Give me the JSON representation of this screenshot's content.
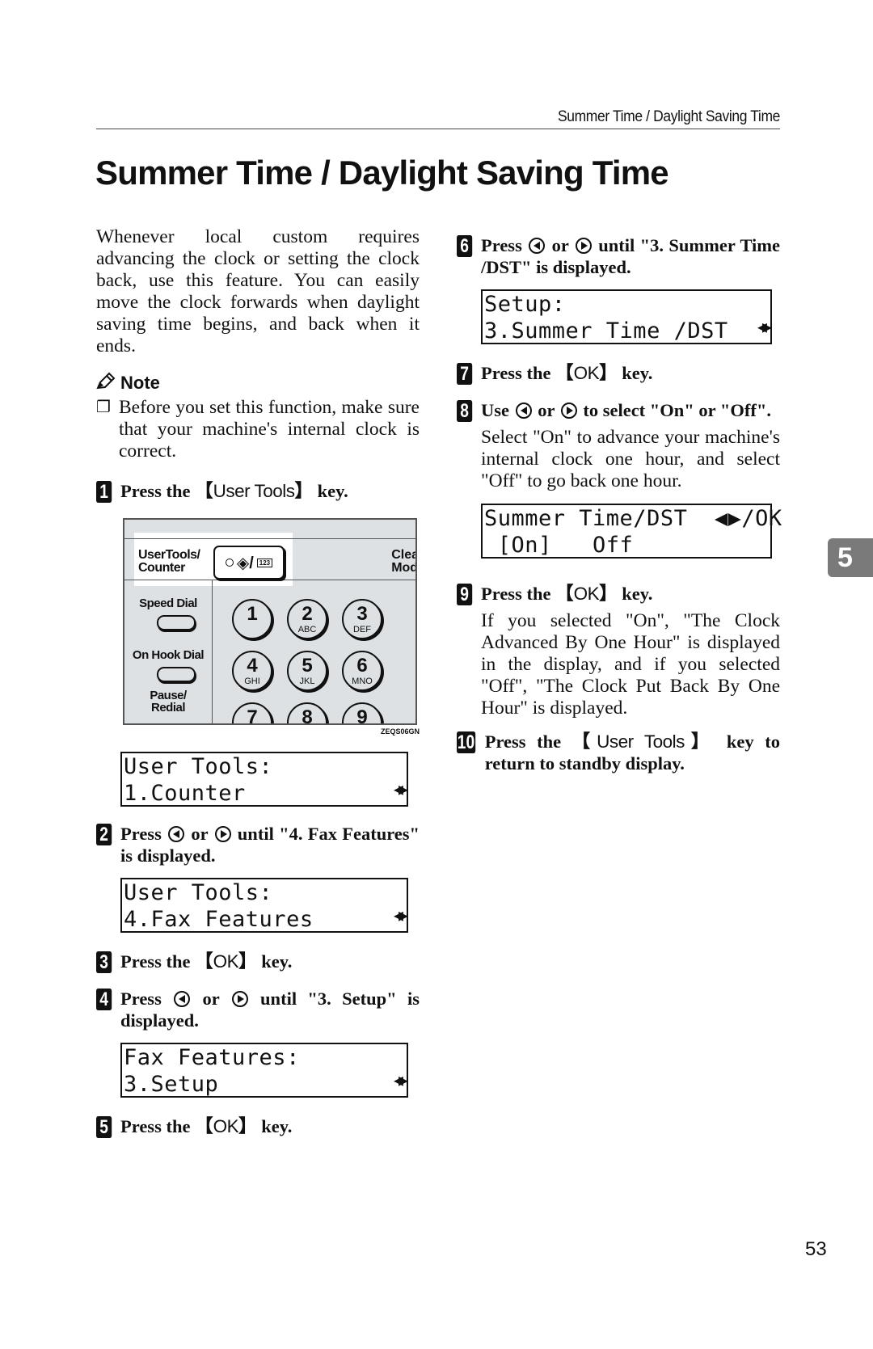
{
  "running_header": "Summer Time / Daylight Saving Time",
  "page_title": "Summer Time / Daylight Saving Time",
  "intro": "Whenever local custom requires advancing the clock or setting the clock back, use this feature. You can easily move the clock forwards when daylight saving time begins, and back when it ends.",
  "note": {
    "label": "Note",
    "items": [
      "Before you set this function, make sure that your machine's internal clock is correct."
    ]
  },
  "steps": [
    {
      "num": "1",
      "pre": "Press the ",
      "key": "User Tools",
      "post": " key."
    },
    {
      "num": "2",
      "pre": "Press",
      "mid": "or",
      "post": "until \"4. Fax Features\" is displayed."
    },
    {
      "num": "3",
      "pre": "Press the ",
      "key": "OK",
      "post": " key."
    },
    {
      "num": "4",
      "pre": "Press",
      "mid": "or",
      "post": "until \"3. Setup\" is displayed."
    },
    {
      "num": "5",
      "pre": "Press the ",
      "key": "OK",
      "post": " key."
    },
    {
      "num": "6",
      "pre": "Press",
      "mid": "or",
      "post": "until \"3. Summer Time /DST\" is displayed."
    },
    {
      "num": "7",
      "pre": "Press the ",
      "key": "OK",
      "post": " key."
    },
    {
      "num": "8",
      "pre": "Use",
      "mid": "or",
      "post": "to select \"On\" or \"Off\".",
      "desc": "Select \"On\" to advance your machine's internal clock one hour, and select \"Off\" to go back one hour."
    },
    {
      "num": "9",
      "pre": "Press the ",
      "key": "OK",
      "post": " key.",
      "desc": "If you selected \"On\", \"The Clock Advanced By One Hour\" is displayed in the display, and if you selected \"Off\", \"The Clock Put Back By One Hour\" is displayed."
    },
    {
      "num": "10",
      "pre": "Press the ",
      "key": "User Tools",
      "post": " key to return to standby display."
    }
  ],
  "lcd_screens": [
    {
      "line1": "User Tools:",
      "line2": "1.Counter",
      "nav": "◀▶"
    },
    {
      "line1": "User Tools:",
      "line2": "4.Fax Features",
      "nav": "◀▶"
    },
    {
      "line1": "Fax Features:",
      "line2": "3.Setup",
      "nav": "◀▶"
    },
    {
      "line1": "Setup:",
      "line2": "3.Summer Time /DST",
      "nav": "◀▶"
    },
    {
      "line1": "Summer Time/DST  ◀▶/OK",
      "line2": " [On]   Off",
      "nav": ""
    }
  ],
  "control_panel": {
    "user_tools_label_1": "UserTools/",
    "user_tools_label_2": "Counter",
    "user_tools_key_badge": "123",
    "clear_label_1": "Clea",
    "clear_label_2": "Mod",
    "speed_dial": "Speed Dial",
    "on_hook_dial": "On Hook Dial",
    "pause_redial_1": "Pause/",
    "pause_redial_2": "Redial",
    "keys": [
      {
        "n": "1",
        "l": ""
      },
      {
        "n": "2",
        "l": "ABC"
      },
      {
        "n": "3",
        "l": "DEF"
      },
      {
        "n": "4",
        "l": "GHI"
      },
      {
        "n": "5",
        "l": "JKL"
      },
      {
        "n": "6",
        "l": "MNO"
      },
      {
        "n": "7",
        "l": ""
      },
      {
        "n": "8",
        "l": ""
      },
      {
        "n": "9",
        "l": ""
      }
    ],
    "figure_code": "ZEQS06GN"
  },
  "chapter_tab": "5",
  "page_number": "53"
}
